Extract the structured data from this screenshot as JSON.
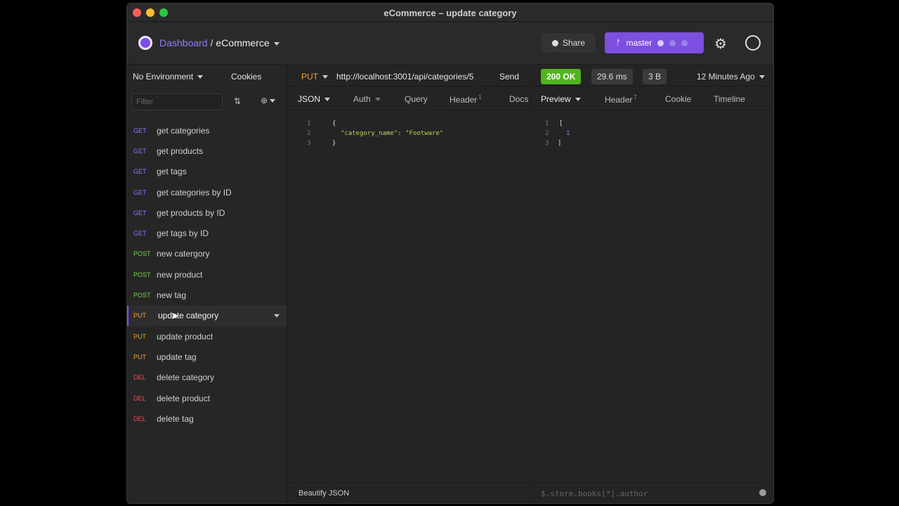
{
  "window": {
    "title": "eCommerce – update category"
  },
  "header": {
    "crumb_link": "Dashboard",
    "crumb_sep": "/",
    "project": "eCommerce",
    "share": "Share",
    "branch": "master"
  },
  "sidebar": {
    "environment": "No Environment",
    "cookies": "Cookies",
    "filter_placeholder": "Filter",
    "items": [
      {
        "method": "GET",
        "name": "get categories"
      },
      {
        "method": "GET",
        "name": "get products"
      },
      {
        "method": "GET",
        "name": "get tags"
      },
      {
        "method": "GET",
        "name": "get categories by ID"
      },
      {
        "method": "GET",
        "name": "get products by ID"
      },
      {
        "method": "GET",
        "name": "get tags by ID"
      },
      {
        "method": "POST",
        "name": "new catergory"
      },
      {
        "method": "POST",
        "name": "new product"
      },
      {
        "method": "POST",
        "name": "new tag"
      },
      {
        "method": "PUT",
        "name": "update category"
      },
      {
        "method": "PUT",
        "name": "update product"
      },
      {
        "method": "PUT",
        "name": "update tag"
      },
      {
        "method": "DEL",
        "name": "delete category"
      },
      {
        "method": "DEL",
        "name": "delete product"
      },
      {
        "method": "DEL",
        "name": "delete tag"
      }
    ]
  },
  "request": {
    "method": "PUT",
    "url": "http://localhost:3001/api/categories/5",
    "send": "Send",
    "tabs": {
      "json": "JSON",
      "auth": "Auth",
      "query": "Query",
      "header": "Header",
      "header_count": "1",
      "docs": "Docs"
    },
    "code": {
      "l1n": "1",
      "l2n": "2",
      "l3n": "3",
      "open": "{",
      "key": "\"category_name\"",
      "colon": ": ",
      "value": "\"Footware\"",
      "close": "}"
    },
    "beautify": "Beautify JSON"
  },
  "response": {
    "status": "200 OK",
    "time": "29.6 ms",
    "size": "3 B",
    "ago": "12 Minutes Ago",
    "tabs": {
      "preview": "Preview",
      "header": "Header",
      "header_count": "7",
      "cookie": "Cookie",
      "timeline": "Timeline"
    },
    "code": {
      "l1n": "1",
      "l2n": "2",
      "l3n": "3",
      "open": "[",
      "value": "1",
      "close": "]"
    },
    "filter_placeholder": "$.store.books[*].author"
  },
  "colors": {
    "accent": "#7c4fe0",
    "get": "#8c75ff",
    "post": "#71d14e",
    "put": "#f0a23b",
    "del": "#e9505a",
    "ok": "#4fb41e"
  }
}
